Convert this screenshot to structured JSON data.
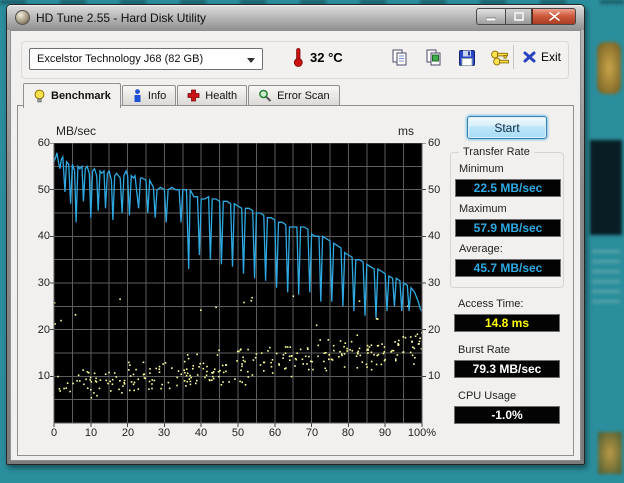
{
  "window": {
    "title": "HD Tune 2.55 - Hard Disk Utility"
  },
  "colors": {
    "desktop": "#2b8e9c",
    "line": "#2fa9e1",
    "scatter": "#ffff9c",
    "grid": "#5e5e5e",
    "chart_bg": "#000000",
    "value_cyan": "#2fa9e1",
    "value_yellow": "#ffff00",
    "value_white": "#ffffff"
  },
  "toolbar": {
    "drive_select": "Excelstor Technology J68 (82 GB)",
    "temperature": "32 °C",
    "exit_label": "Exit"
  },
  "tabs": [
    {
      "label": "Benchmark",
      "active": true
    },
    {
      "label": "Info",
      "active": false
    },
    {
      "label": "Health",
      "active": false
    },
    {
      "label": "Error Scan",
      "active": false
    }
  ],
  "results": {
    "start_label": "Start",
    "transfer": {
      "title": "Transfer Rate",
      "rows": [
        {
          "label": "Minimum",
          "value": "22.5 MB/sec",
          "color": "#2fa9e1"
        },
        {
          "label": "Maximum",
          "value": "57.9 MB/sec",
          "color": "#2fa9e1"
        },
        {
          "label": "Average:",
          "value": "45.7 MB/sec",
          "color": "#2fa9e1"
        }
      ]
    },
    "extras": [
      {
        "label": "Access Time:",
        "value": "14.8 ms",
        "color": "#ffff00"
      },
      {
        "label": "Burst Rate",
        "value": "79.3 MB/sec",
        "color": "#ffffff"
      },
      {
        "label": "CPU Usage",
        "value": "-1.0%",
        "color": "#ffffff"
      }
    ]
  },
  "chart_data": {
    "type": "line+scatter",
    "left_unit": "MB/sec",
    "right_unit": "ms",
    "xlim": [
      0,
      100
    ],
    "ylim": [
      0,
      60
    ],
    "grid_step_x": 5,
    "grid_step_y": 5,
    "x_ticks": [
      {
        "v": 0,
        "label": "0"
      },
      {
        "v": 10,
        "label": "10"
      },
      {
        "v": 20,
        "label": "20"
      },
      {
        "v": 30,
        "label": "30"
      },
      {
        "v": 40,
        "label": "40"
      },
      {
        "v": 50,
        "label": "50"
      },
      {
        "v": 60,
        "label": "60"
      },
      {
        "v": 70,
        "label": "70"
      },
      {
        "v": 80,
        "label": "80"
      },
      {
        "v": 90,
        "label": "90"
      },
      {
        "v": 100,
        "label": "100%"
      }
    ],
    "y_ticks": [
      10,
      20,
      30,
      40,
      50,
      60
    ],
    "series": [
      {
        "name": "transfer_rate_mb_per_sec",
        "color": "#2fa9e1",
        "points": [
          [
            0,
            56
          ],
          [
            0.5,
            57
          ],
          [
            0.8,
            57.9
          ],
          [
            1.2,
            56
          ],
          [
            1.6,
            54.5
          ],
          [
            2,
            56.5
          ],
          [
            2.4,
            57
          ],
          [
            3,
            49.5
          ],
          [
            3.4,
            56
          ],
          [
            4,
            55.5
          ],
          [
            4.5,
            47
          ],
          [
            5,
            55.5
          ],
          [
            5.6,
            54
          ],
          [
            6,
            43
          ],
          [
            6.5,
            55
          ],
          [
            7,
            54.5
          ],
          [
            7.6,
            55
          ],
          [
            8,
            47.5
          ],
          [
            8.5,
            54.5
          ],
          [
            9,
            55
          ],
          [
            9.6,
            53.5
          ],
          [
            10,
            44
          ],
          [
            10.5,
            54
          ],
          [
            11,
            54.5
          ],
          [
            11.6,
            53
          ],
          [
            12,
            45.5
          ],
          [
            12.5,
            54
          ],
          [
            13,
            53.5
          ],
          [
            13.6,
            54
          ],
          [
            14,
            46
          ],
          [
            14.5,
            53.5
          ],
          [
            15,
            54
          ],
          [
            15.6,
            52
          ],
          [
            16,
            43.5
          ],
          [
            16.5,
            53
          ],
          [
            17,
            53.5
          ],
          [
            18,
            52.5
          ],
          [
            18.5,
            45
          ],
          [
            19,
            53
          ],
          [
            19.6,
            54
          ],
          [
            20,
            53
          ],
          [
            20.5,
            44.5
          ],
          [
            21,
            53
          ],
          [
            21.6,
            52.5
          ],
          [
            22,
            53
          ],
          [
            23,
            46
          ],
          [
            23.5,
            52.5
          ],
          [
            24,
            52.5
          ],
          [
            25,
            52
          ],
          [
            25.5,
            45
          ],
          [
            26,
            52
          ],
          [
            27,
            50.5
          ],
          [
            27.5,
            44
          ],
          [
            28,
            50
          ],
          [
            29,
            50.5
          ],
          [
            30,
            50
          ],
          [
            30.5,
            43
          ],
          [
            31,
            50
          ],
          [
            32,
            50.5
          ],
          [
            33,
            50
          ],
          [
            34,
            50
          ],
          [
            34.5,
            43
          ],
          [
            35,
            50
          ],
          [
            36,
            50
          ],
          [
            36.6,
            33
          ],
          [
            37,
            50
          ],
          [
            38,
            48.5
          ],
          [
            39,
            48.5
          ],
          [
            39.5,
            36
          ],
          [
            40,
            48
          ],
          [
            41,
            48
          ],
          [
            42,
            48.5
          ],
          [
            42.5,
            35
          ],
          [
            43,
            48
          ],
          [
            44,
            48
          ],
          [
            45,
            47.5
          ],
          [
            45.5,
            34
          ],
          [
            46,
            47.5
          ],
          [
            47,
            47.5
          ],
          [
            48,
            47
          ],
          [
            48.5,
            33.5
          ],
          [
            49,
            47
          ],
          [
            50,
            46.5
          ],
          [
            51,
            46
          ],
          [
            51.5,
            32
          ],
          [
            52,
            46
          ],
          [
            53,
            46
          ],
          [
            54,
            45.5
          ],
          [
            54.5,
            31
          ],
          [
            55,
            45
          ],
          [
            56,
            45
          ],
          [
            57,
            44.5
          ],
          [
            57.5,
            30.5
          ],
          [
            58,
            44
          ],
          [
            59,
            44
          ],
          [
            60,
            43.5
          ],
          [
            60.5,
            29
          ],
          [
            61,
            43
          ],
          [
            62,
            43
          ],
          [
            63,
            42.5
          ],
          [
            63.5,
            28
          ],
          [
            64,
            42
          ],
          [
            65,
            42
          ],
          [
            66,
            42
          ],
          [
            66.5,
            27.5
          ],
          [
            67,
            42
          ],
          [
            68,
            42
          ],
          [
            69,
            41.5
          ],
          [
            69.5,
            28
          ],
          [
            70,
            40.5
          ],
          [
            71,
            40
          ],
          [
            72,
            40
          ],
          [
            72.5,
            26
          ],
          [
            73,
            40
          ],
          [
            74,
            39.5
          ],
          [
            75,
            39
          ],
          [
            75.5,
            26
          ],
          [
            76,
            38.5
          ],
          [
            77,
            38
          ],
          [
            78,
            37.5
          ],
          [
            78.5,
            25
          ],
          [
            79,
            36.5
          ],
          [
            80,
            36
          ],
          [
            81,
            35.5
          ],
          [
            81.5,
            24
          ],
          [
            82,
            35
          ],
          [
            83,
            35
          ],
          [
            84,
            34.5
          ],
          [
            84.5,
            23
          ],
          [
            85,
            34
          ],
          [
            86,
            33.5
          ],
          [
            87,
            33
          ],
          [
            87.5,
            22.5
          ],
          [
            88,
            33
          ],
          [
            89,
            32.5
          ],
          [
            90,
            32
          ],
          [
            90.5,
            24
          ],
          [
            91,
            31.5
          ],
          [
            92,
            31
          ],
          [
            92.5,
            25
          ],
          [
            93,
            31
          ],
          [
            94,
            30.5
          ],
          [
            94.5,
            24
          ],
          [
            95,
            30
          ],
          [
            96,
            29.5
          ],
          [
            96.5,
            24
          ],
          [
            97,
            29
          ],
          [
            98,
            28
          ],
          [
            99,
            26
          ],
          [
            99.5,
            24.5
          ],
          [
            100,
            24
          ]
        ]
      }
    ],
    "scatter": {
      "name": "access_time_ms",
      "color": "#ffff9c",
      "count": 300,
      "seed": 1337,
      "base_start": 8,
      "base_end": 16.5,
      "spread": 4.3,
      "y_min": 4,
      "y_max": 20.5,
      "outliers": {
        "count": 16,
        "y_min": 20.5,
        "y_max": 28
      }
    }
  }
}
